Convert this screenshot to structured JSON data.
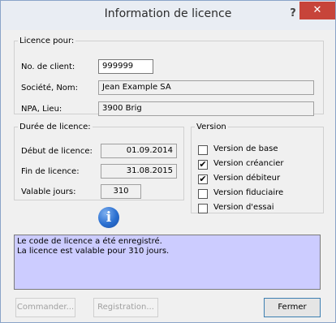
{
  "window": {
    "title": "Information de licence",
    "help_glyph": "?",
    "close_glyph": "✕"
  },
  "licence_for": {
    "legend": "Licence pour:",
    "client_no_label": "No. de client:",
    "client_no_value": "999999",
    "company_label": "Société, Nom:",
    "company_value": "Jean Example SA",
    "npa_label": "NPA, Lieu:",
    "npa_value": "3900 Brig"
  },
  "duration": {
    "legend": "Durée de licence:",
    "start_label": "Début de licence:",
    "start_value": "01.09.2014",
    "end_label": "Fin de licence:",
    "end_value": "31.08.2015",
    "days_label": "Valable jours:",
    "days_value": "310"
  },
  "version": {
    "legend": "Version",
    "options": [
      {
        "label": "Version de base",
        "checked": false
      },
      {
        "label": "Version créancier",
        "checked": true
      },
      {
        "label": "Version débiteur",
        "checked": true
      },
      {
        "label": "Version fiduciaire",
        "checked": false
      },
      {
        "label": "Version d'essai",
        "checked": false
      }
    ]
  },
  "info_icon_glyph": "i",
  "message": {
    "line1": "Le code de licence a été enregistré.",
    "line2": "La licence est valable pour 310 jours."
  },
  "buttons": {
    "order": "Commander...",
    "registration": "Registration...",
    "close": "Fermer"
  },
  "colors": {
    "message_bg": "#ccccff",
    "close_button": "#c7443a",
    "info_icon": "#2a6fd0"
  }
}
